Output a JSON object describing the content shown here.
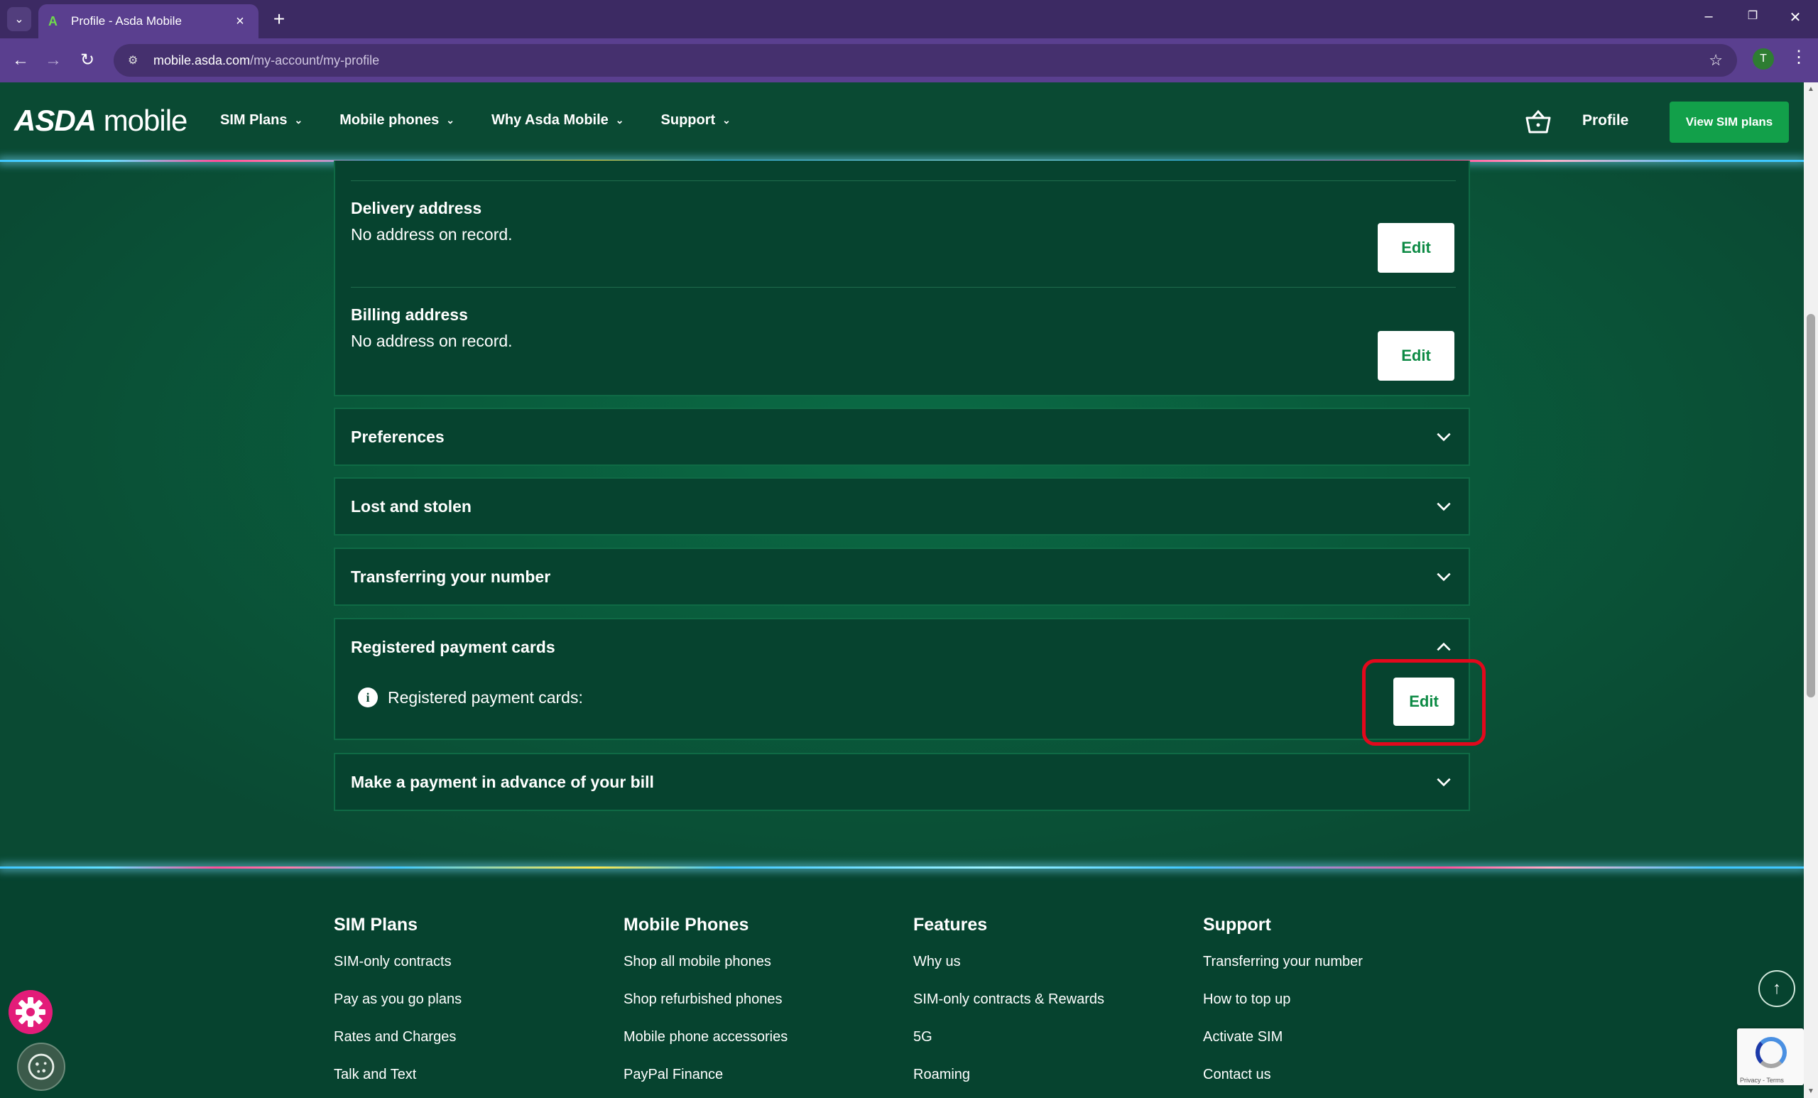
{
  "browser": {
    "tab_title": "Profile - Asda Mobile",
    "tab_favicon": "A",
    "url_domain": "mobile.asda.com",
    "url_path": "/my-account/my-profile",
    "profile_initial": "T"
  },
  "header": {
    "logo_brand": "ASDA",
    "logo_suffix": "mobile",
    "nav": [
      {
        "label": "SIM Plans"
      },
      {
        "label": "Mobile phones"
      },
      {
        "label": "Why Asda Mobile"
      },
      {
        "label": "Support"
      }
    ],
    "profile_label": "Profile",
    "cta_label": "View SIM plans"
  },
  "addresses": {
    "delivery": {
      "label": "Delivery address",
      "value": "No address on record.",
      "edit": "Edit"
    },
    "billing": {
      "label": "Billing address",
      "value": "No address on record.",
      "edit": "Edit"
    }
  },
  "sections": {
    "preferences": "Preferences",
    "lost_stolen": "Lost and stolen",
    "transferring": "Transferring your number",
    "payment_cards": {
      "label": "Registered payment cards",
      "info": "Registered payment cards:",
      "edit": "Edit"
    },
    "advance_payment": "Make a payment in advance of your bill"
  },
  "footer": {
    "columns": [
      {
        "heading": "SIM Plans",
        "links": [
          "SIM-only contracts",
          "Pay as you go plans",
          "Rates and Charges",
          "Talk and Text"
        ]
      },
      {
        "heading": "Mobile Phones",
        "links": [
          "Shop all mobile phones",
          "Shop refurbished phones",
          "Mobile phone accessories",
          "PayPal Finance"
        ]
      },
      {
        "heading": "Features",
        "links": [
          "Why us",
          "SIM-only contracts & Rewards",
          "5G",
          "Roaming"
        ]
      },
      {
        "heading": "Support",
        "links": [
          "Transferring your number",
          "How to top up",
          "Activate SIM",
          "Contact us"
        ]
      }
    ]
  },
  "recaptcha_text": "Privacy - Terms",
  "colors": {
    "brand_green": "#12a04a",
    "highlight": "#e3081c",
    "page_bg": "#0a4a33"
  }
}
